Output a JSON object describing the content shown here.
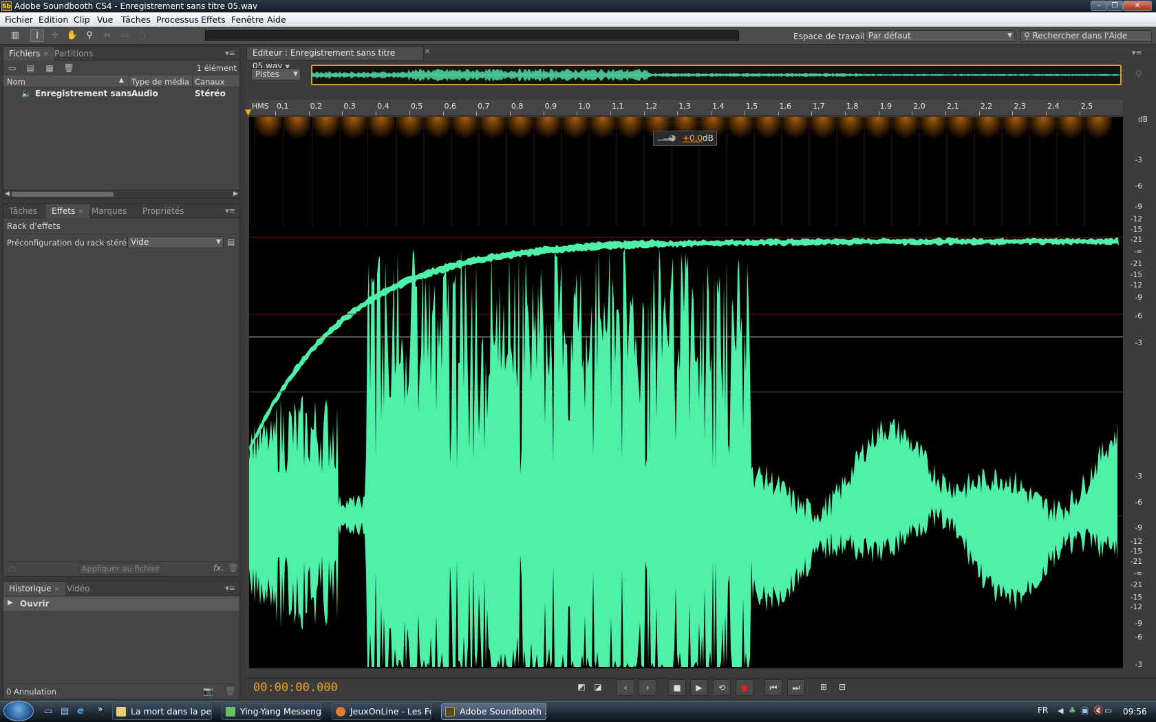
{
  "window": {
    "title": "Adobe Soundbooth CS4 - Enregistrement sans titre 05.wav",
    "logo_text": "Sb"
  },
  "menu": [
    "Fichier",
    "Edition",
    "Clip",
    "Vue",
    "Tâches",
    "Processus",
    "Effets",
    "Fenêtre",
    "Aide"
  ],
  "toolbar": {
    "workspace_label": "Espace de travail :",
    "workspace_value": "Par défaut",
    "search_placeholder": "Rechercher dans l'Aide"
  },
  "files_panel": {
    "tabs": [
      "Fichiers",
      "Partitions"
    ],
    "count": "1 élément",
    "columns": [
      "Nom",
      "Type de média",
      "Canaux"
    ],
    "rows": [
      {
        "name": "Enregistrement sans ...",
        "type": "Audio",
        "channels": "Stéréo"
      }
    ]
  },
  "effects_panel": {
    "tabs": [
      "Tâches",
      "Effets",
      "Marques",
      "Propriétés"
    ],
    "rack_title": "Rack d'effets",
    "preset_label": "Préconfiguration du rack stéréo :",
    "preset_value": "Vide",
    "apply_label": "Appliquer au fichier",
    "fx_label": "fx."
  },
  "history_panel": {
    "tabs": [
      "Historique",
      "Vidéo"
    ],
    "items": [
      "Ouvrir"
    ],
    "status": "0 Annulation"
  },
  "editor": {
    "tab_label": "Editeur : Enregistrement sans titre 05.wav",
    "view_select": "Pistes",
    "ruler_unit": "HMS",
    "ruler_ticks": [
      "0,1",
      "0,2",
      "0,3",
      "0,4",
      "0,5",
      "0,6",
      "0,7",
      "0,8",
      "0,9",
      "1,0",
      "1,1",
      "1,2",
      "1,3",
      "1,4",
      "1,5",
      "1,6",
      "1,7",
      "1,8",
      "1,9",
      "2,0",
      "2,1",
      "2,2",
      "2,3",
      "2,4",
      "2,5"
    ],
    "db_unit": "dB",
    "db_labels_upper": [
      "-3",
      "-6",
      "-9",
      "-12",
      "-15",
      "-21",
      "-∞",
      "-21",
      "-15",
      "-12",
      "-9",
      "-6",
      "-3"
    ],
    "db_labels_lower": [
      "-3",
      "-6",
      "-9",
      "-12",
      "-15",
      "-21",
      "-∞",
      "-21",
      "-15",
      "-12",
      "-9",
      "-6",
      "-3"
    ],
    "gain_value": "+0,0",
    "gain_unit": "dB",
    "timecode": "00:00:00.000",
    "waveform_color": "#4ff0a8",
    "fade_color": "#c06a10"
  },
  "taskbar": {
    "items": [
      "La mort dans la pea...",
      "Ying-Yang Messenger",
      "JeuxOnLine - Les Fo...",
      "Adobe Soundbooth ..."
    ],
    "lang": "FR",
    "time": "09:56"
  }
}
